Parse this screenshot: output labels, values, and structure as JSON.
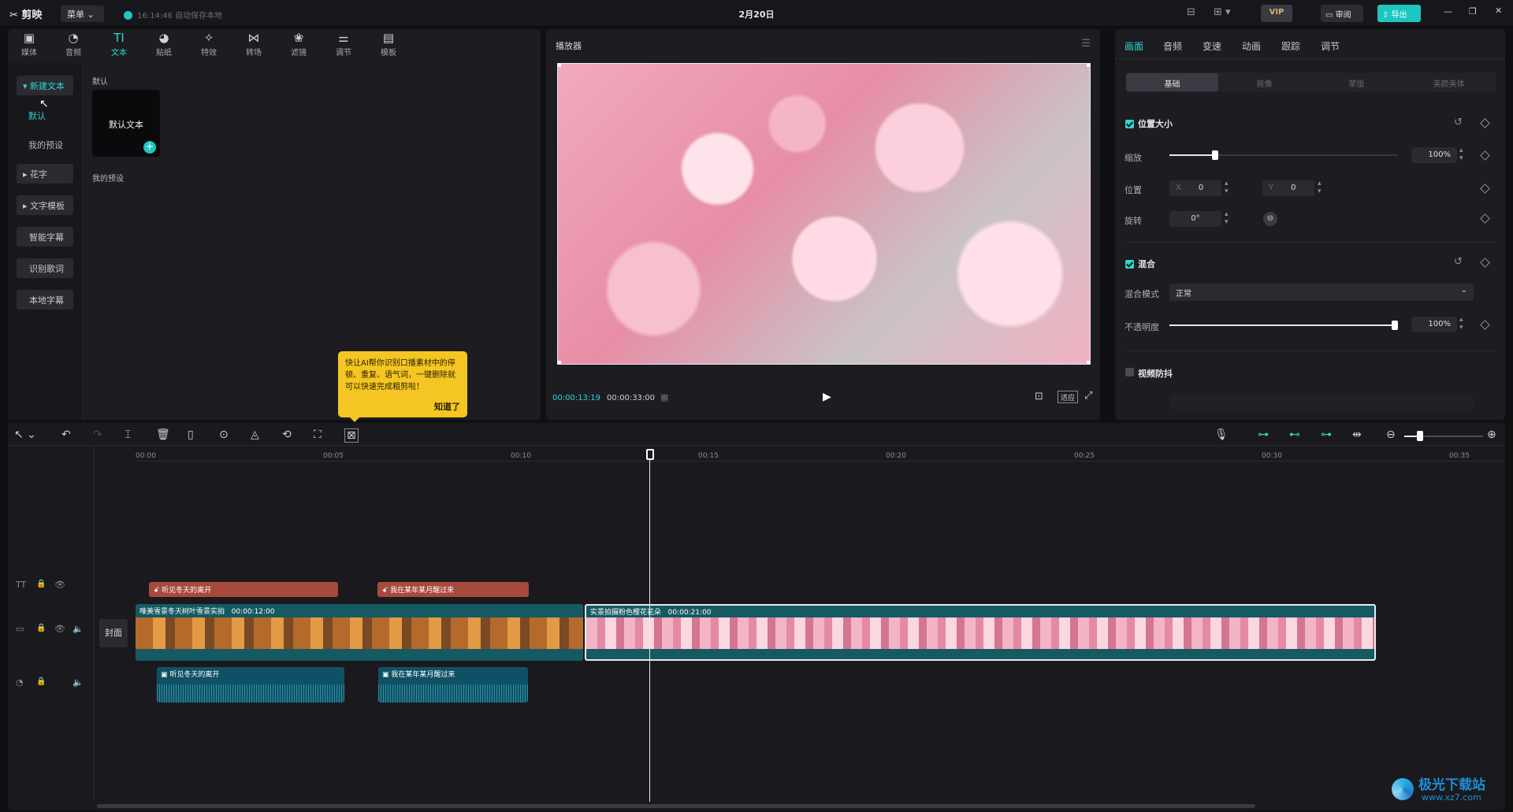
{
  "app": {
    "logo": "剪映",
    "menu": "菜单",
    "autosave": "16:14:46 自动保存本地",
    "title": "2月20日"
  },
  "topbar": {
    "vip": "VIP",
    "review": "审阅",
    "export": "导出"
  },
  "toolbar": [
    {
      "label": "媒体",
      "icon": "media-icon",
      "glyph": "▣"
    },
    {
      "label": "音频",
      "icon": "audio-icon",
      "glyph": "◔"
    },
    {
      "label": "文本",
      "icon": "text-icon",
      "glyph": "TI"
    },
    {
      "label": "贴纸",
      "icon": "sticker-icon",
      "glyph": "◕"
    },
    {
      "label": "特效",
      "icon": "effects-icon",
      "glyph": "✧"
    },
    {
      "label": "转场",
      "icon": "transition-icon",
      "glyph": "⋈"
    },
    {
      "label": "滤镜",
      "icon": "filter-icon",
      "glyph": "❀"
    },
    {
      "label": "调节",
      "icon": "adjust-icon",
      "glyph": "⚌"
    },
    {
      "label": "模板",
      "icon": "template-icon",
      "glyph": "▤"
    }
  ],
  "left_sidebar": {
    "new_text": "新建文本",
    "sub_default": "默认",
    "sub_preset": "我的预设",
    "items": [
      "花字",
      "文字模板",
      "智能字幕",
      "识别歌词",
      "本地字幕"
    ]
  },
  "text_panel": {
    "section_default": "默认",
    "card_label": "默认文本",
    "section_preset": "我的预设"
  },
  "tooltip": {
    "text": "快让AI帮你识别口播素材中的停顿、重复、语气词，一键删除就可以快速完成粗剪啦！",
    "button": "知道了"
  },
  "player": {
    "title": "播放器",
    "current_time": "00:00:13:19",
    "total_time": "00:00:33:00",
    "fit_label": "适应"
  },
  "right_panel": {
    "tabs": [
      "画面",
      "音频",
      "变速",
      "动画",
      "跟踪",
      "调节"
    ],
    "subtabs": [
      "基础",
      "抠像",
      "蒙版",
      "美颜美体"
    ],
    "pos_size": {
      "title": "位置大小",
      "scale_label": "缩放",
      "scale_value": "100%",
      "scale_fraction": 0.2,
      "position_label": "位置",
      "x_label": "X",
      "x_value": "0",
      "y_label": "Y",
      "y_value": "0",
      "rotate_label": "旋转",
      "rotate_value": "0°"
    },
    "blend": {
      "title": "混合",
      "mode_label": "混合模式",
      "mode_value": "正常",
      "opacity_label": "不透明度",
      "opacity_value": "100%",
      "opacity_fraction": 1.0
    },
    "stabilize": {
      "title": "视频防抖"
    }
  },
  "timeline": {
    "ticks": [
      "00:00",
      "00:05",
      "00:10",
      "00:15",
      "00:20",
      "00:25",
      "00:30",
      "00:35"
    ],
    "cover_label": "封面",
    "text_clips": [
      "听见冬天的离开",
      "我在某年某月醒过来"
    ],
    "video_clips": [
      {
        "title": "唯美雪景冬天树叶雪景实拍",
        "duration": "00:00:12:00"
      },
      {
        "title": "实景拍摄粉色樱花花朵",
        "duration": "00:00:21:00"
      }
    ],
    "audio_clips": [
      "听见冬天的离开",
      "我在某年某月醒过来"
    ]
  },
  "watermark": {
    "title": "极光下载站",
    "url": "www.xz7.com"
  }
}
